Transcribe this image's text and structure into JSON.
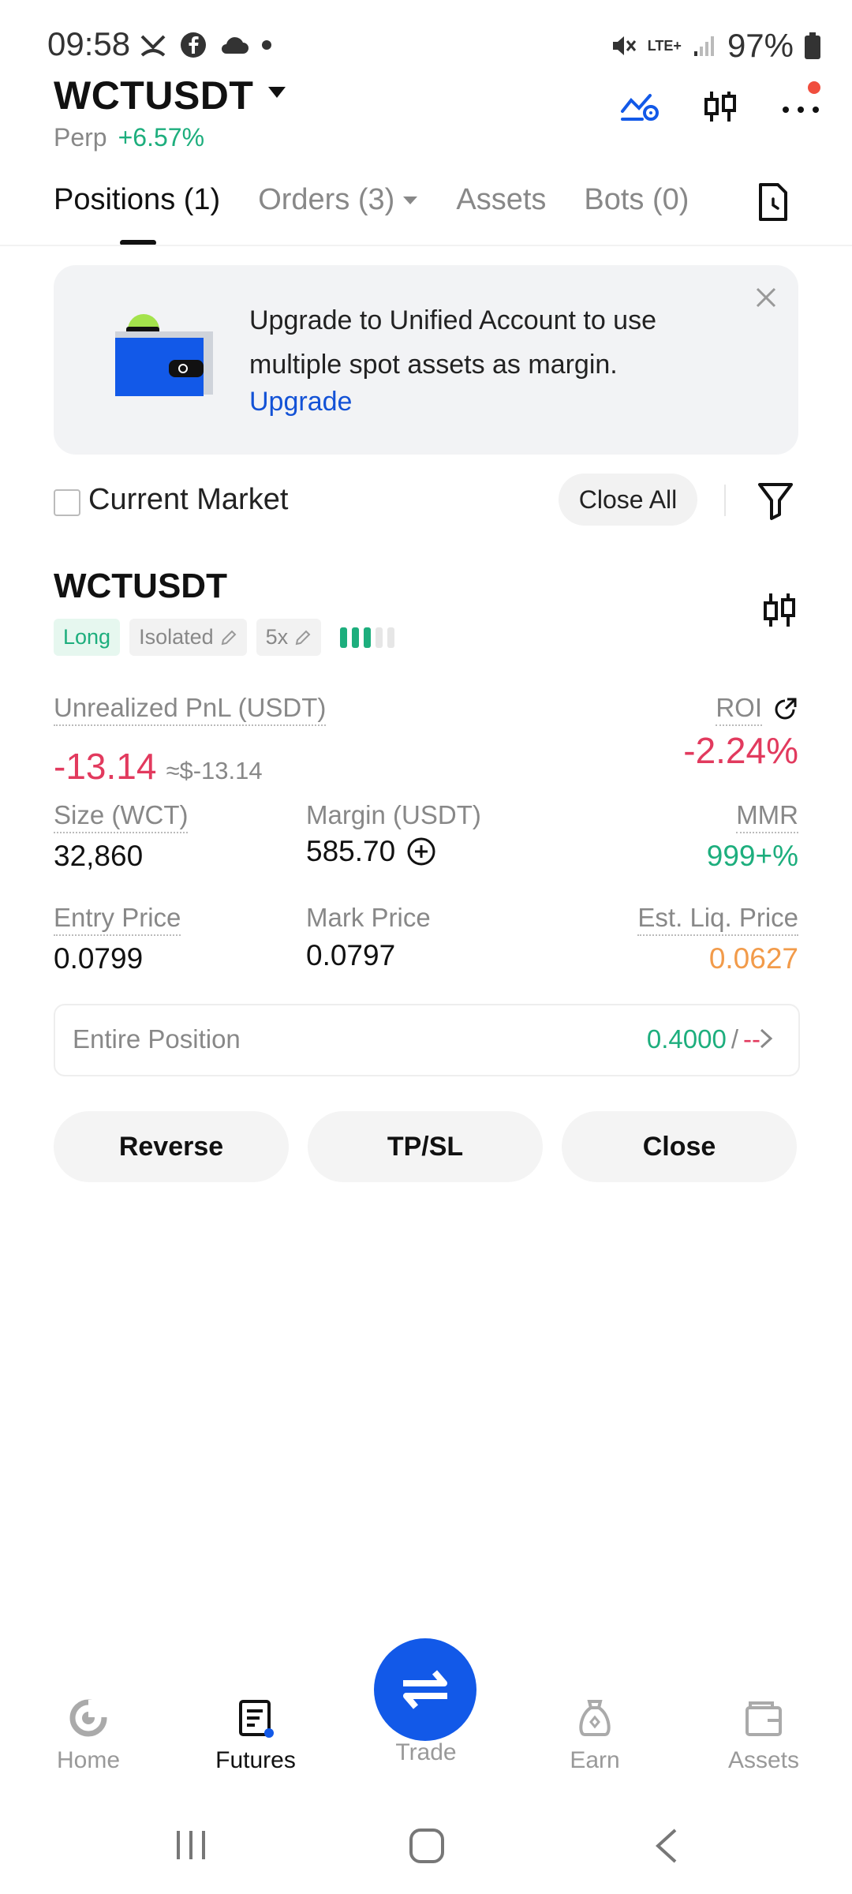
{
  "status_bar": {
    "time": "09:58",
    "network": "LTE+",
    "battery": "97%"
  },
  "header": {
    "pair": "WCTUSDT",
    "contract_type": "Perp",
    "change": "+6.57%"
  },
  "tabs": [
    {
      "label": "Positions (1)",
      "active": true
    },
    {
      "label": "Orders (3)",
      "active": false
    },
    {
      "label": "Assets",
      "active": false
    },
    {
      "label": "Bots (0)",
      "active": false
    }
  ],
  "banner": {
    "text": "Upgrade to Unified Account to use multiple spot assets as margin.",
    "link": "Upgrade"
  },
  "filter_row": {
    "current_market_label": "Current Market",
    "close_all_label": "Close All"
  },
  "position": {
    "symbol": "WCTUSDT",
    "side": "Long",
    "margin_mode": "Isolated",
    "leverage": "5x",
    "risk_level": 3,
    "risk_level_max": 5,
    "unrealized_pnl_label": "Unrealized PnL (USDT)",
    "unrealized_pnl": "-13.14",
    "unrealized_pnl_usd": "≈$-13.14",
    "roi_label": "ROI",
    "roi": "-2.24%",
    "size_label": "Size (WCT)",
    "size": "32,860",
    "margin_label": "Margin (USDT)",
    "margin": "585.70",
    "mmr_label": "MMR",
    "mmr": "999+%",
    "entry_price_label": "Entry Price",
    "entry_price": "0.0799",
    "mark_price_label": "Mark Price",
    "mark_price": "0.0797",
    "liq_price_label": "Est. Liq. Price",
    "liq_price": "0.0627",
    "entire_position_label": "Entire Position",
    "entire_tp": "0.4000",
    "entire_sep": "/",
    "entire_sl": "--"
  },
  "actions": {
    "reverse": "Reverse",
    "tpsl": "TP/SL",
    "close": "Close"
  },
  "bottom_nav": [
    {
      "label": "Home",
      "active": false
    },
    {
      "label": "Futures",
      "active": true
    },
    {
      "label": "Trade",
      "active": false
    },
    {
      "label": "Earn",
      "active": false
    },
    {
      "label": "Assets",
      "active": false
    }
  ],
  "colors": {
    "green": "#1dae7d",
    "red": "#e23a5e",
    "orange": "#f29b4a",
    "blue": "#1259e8",
    "link_blue": "#1352d6"
  }
}
